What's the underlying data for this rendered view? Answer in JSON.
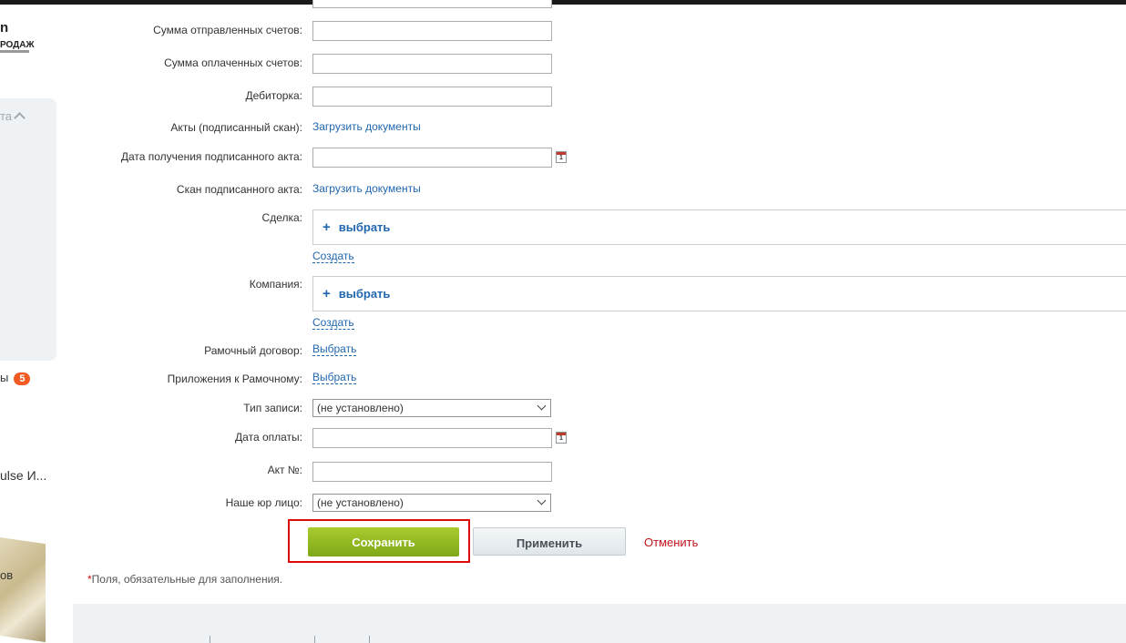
{
  "sidebar": {
    "logo_main": "n",
    "logo_sub": "РОДАЖ",
    "section_label": "та",
    "counter_label": "ы",
    "counter_value": "5",
    "pulse_label": "ulse И...",
    "promo_label": "ов"
  },
  "form": {
    "fields": {
      "sent_invoices_label": "Сумма отправленных счетов:",
      "sent_invoices_value": "",
      "paid_invoices_label": "Сумма оплаченных счетов:",
      "paid_invoices_value": "",
      "receivables_label": "Дебиторка:",
      "receivables_value": "",
      "acts_scan_label": "Акты (подписанный скан):",
      "acts_scan_link": "Загрузить документы",
      "act_received_date_label": "Дата получения подписанного акта:",
      "act_received_date_value": "",
      "act_scan_label": "Скан подписанного акта:",
      "act_scan_link": "Загрузить документы",
      "deal_label": "Сделка:",
      "deal_choose": "выбрать",
      "deal_create": "Создать",
      "company_label": "Компания:",
      "company_choose": "выбрать",
      "company_create": "Создать",
      "framework_contract_label": "Рамочный договор:",
      "framework_contract_link": "Выбрать",
      "framework_appendix_label": "Приложения к Рамочному:",
      "framework_appendix_link": "Выбрать",
      "record_type_label": "Тип записи:",
      "record_type_value": "(не установлено)",
      "payment_date_label": "Дата оплаты:",
      "payment_date_value": "",
      "act_number_label": "Акт №:",
      "act_number_value": "",
      "legal_entity_label": "Наше юр лицо:",
      "legal_entity_value": "(не установлено)"
    },
    "calendar_icon_glyph": "1",
    "plus_glyph": "+",
    "buttons": {
      "save": "Сохранить",
      "apply": "Применить",
      "cancel": "Отменить"
    },
    "required_star": "*",
    "required_note": "Поля, обязательные для заполнения."
  },
  "colors": {
    "save_button": "#8cb624",
    "link": "#2067b0",
    "cancel": "#c0141c",
    "highlight": "#e00a0a",
    "badge": "#f15a22"
  }
}
